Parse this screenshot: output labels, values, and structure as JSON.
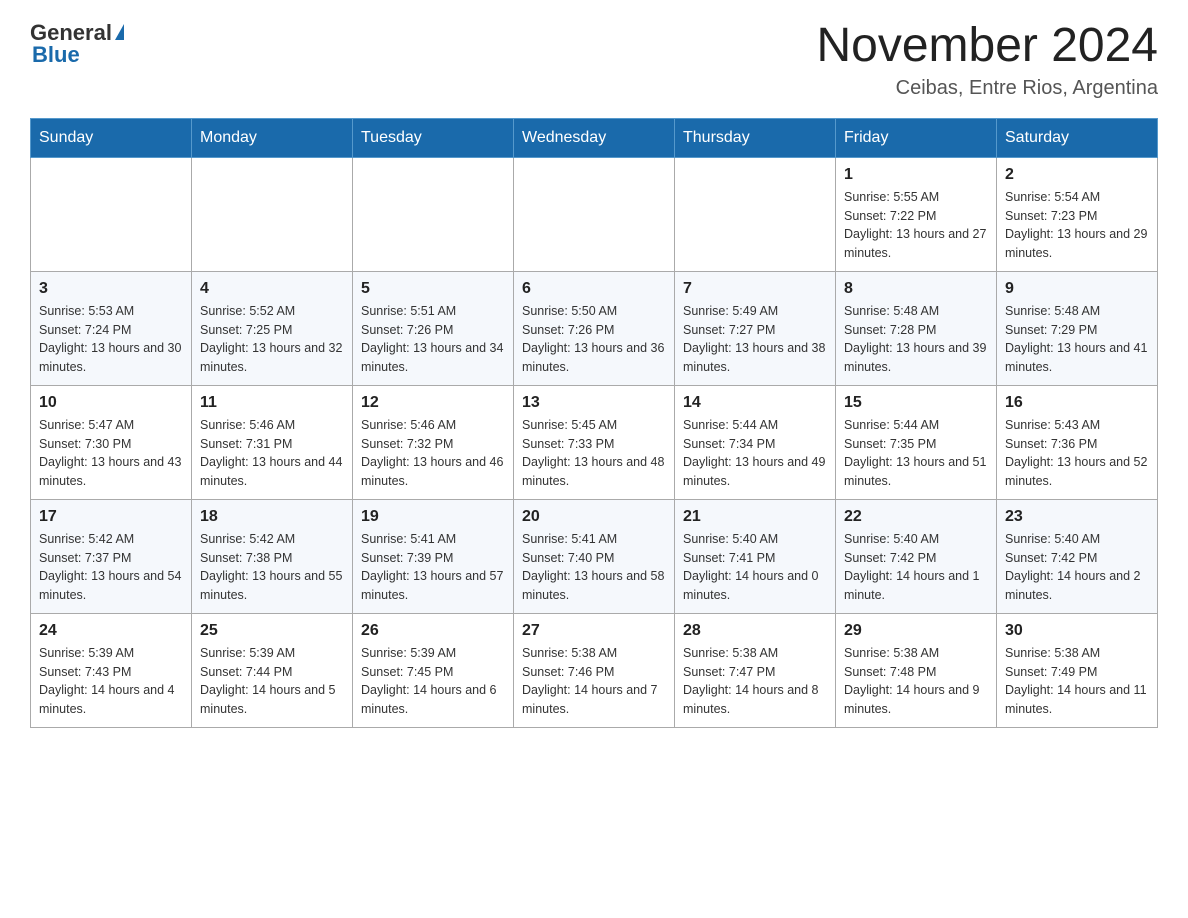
{
  "header": {
    "logo_general": "General",
    "logo_blue": "Blue",
    "month_title": "November 2024",
    "location": "Ceibas, Entre Rios, Argentina"
  },
  "weekdays": [
    "Sunday",
    "Monday",
    "Tuesday",
    "Wednesday",
    "Thursday",
    "Friday",
    "Saturday"
  ],
  "weeks": [
    [
      {
        "day": "",
        "info": ""
      },
      {
        "day": "",
        "info": ""
      },
      {
        "day": "",
        "info": ""
      },
      {
        "day": "",
        "info": ""
      },
      {
        "day": "",
        "info": ""
      },
      {
        "day": "1",
        "info": "Sunrise: 5:55 AM\nSunset: 7:22 PM\nDaylight: 13 hours and 27 minutes."
      },
      {
        "day": "2",
        "info": "Sunrise: 5:54 AM\nSunset: 7:23 PM\nDaylight: 13 hours and 29 minutes."
      }
    ],
    [
      {
        "day": "3",
        "info": "Sunrise: 5:53 AM\nSunset: 7:24 PM\nDaylight: 13 hours and 30 minutes."
      },
      {
        "day": "4",
        "info": "Sunrise: 5:52 AM\nSunset: 7:25 PM\nDaylight: 13 hours and 32 minutes."
      },
      {
        "day": "5",
        "info": "Sunrise: 5:51 AM\nSunset: 7:26 PM\nDaylight: 13 hours and 34 minutes."
      },
      {
        "day": "6",
        "info": "Sunrise: 5:50 AM\nSunset: 7:26 PM\nDaylight: 13 hours and 36 minutes."
      },
      {
        "day": "7",
        "info": "Sunrise: 5:49 AM\nSunset: 7:27 PM\nDaylight: 13 hours and 38 minutes."
      },
      {
        "day": "8",
        "info": "Sunrise: 5:48 AM\nSunset: 7:28 PM\nDaylight: 13 hours and 39 minutes."
      },
      {
        "day": "9",
        "info": "Sunrise: 5:48 AM\nSunset: 7:29 PM\nDaylight: 13 hours and 41 minutes."
      }
    ],
    [
      {
        "day": "10",
        "info": "Sunrise: 5:47 AM\nSunset: 7:30 PM\nDaylight: 13 hours and 43 minutes."
      },
      {
        "day": "11",
        "info": "Sunrise: 5:46 AM\nSunset: 7:31 PM\nDaylight: 13 hours and 44 minutes."
      },
      {
        "day": "12",
        "info": "Sunrise: 5:46 AM\nSunset: 7:32 PM\nDaylight: 13 hours and 46 minutes."
      },
      {
        "day": "13",
        "info": "Sunrise: 5:45 AM\nSunset: 7:33 PM\nDaylight: 13 hours and 48 minutes."
      },
      {
        "day": "14",
        "info": "Sunrise: 5:44 AM\nSunset: 7:34 PM\nDaylight: 13 hours and 49 minutes."
      },
      {
        "day": "15",
        "info": "Sunrise: 5:44 AM\nSunset: 7:35 PM\nDaylight: 13 hours and 51 minutes."
      },
      {
        "day": "16",
        "info": "Sunrise: 5:43 AM\nSunset: 7:36 PM\nDaylight: 13 hours and 52 minutes."
      }
    ],
    [
      {
        "day": "17",
        "info": "Sunrise: 5:42 AM\nSunset: 7:37 PM\nDaylight: 13 hours and 54 minutes."
      },
      {
        "day": "18",
        "info": "Sunrise: 5:42 AM\nSunset: 7:38 PM\nDaylight: 13 hours and 55 minutes."
      },
      {
        "day": "19",
        "info": "Sunrise: 5:41 AM\nSunset: 7:39 PM\nDaylight: 13 hours and 57 minutes."
      },
      {
        "day": "20",
        "info": "Sunrise: 5:41 AM\nSunset: 7:40 PM\nDaylight: 13 hours and 58 minutes."
      },
      {
        "day": "21",
        "info": "Sunrise: 5:40 AM\nSunset: 7:41 PM\nDaylight: 14 hours and 0 minutes."
      },
      {
        "day": "22",
        "info": "Sunrise: 5:40 AM\nSunset: 7:42 PM\nDaylight: 14 hours and 1 minute."
      },
      {
        "day": "23",
        "info": "Sunrise: 5:40 AM\nSunset: 7:42 PM\nDaylight: 14 hours and 2 minutes."
      }
    ],
    [
      {
        "day": "24",
        "info": "Sunrise: 5:39 AM\nSunset: 7:43 PM\nDaylight: 14 hours and 4 minutes."
      },
      {
        "day": "25",
        "info": "Sunrise: 5:39 AM\nSunset: 7:44 PM\nDaylight: 14 hours and 5 minutes."
      },
      {
        "day": "26",
        "info": "Sunrise: 5:39 AM\nSunset: 7:45 PM\nDaylight: 14 hours and 6 minutes."
      },
      {
        "day": "27",
        "info": "Sunrise: 5:38 AM\nSunset: 7:46 PM\nDaylight: 14 hours and 7 minutes."
      },
      {
        "day": "28",
        "info": "Sunrise: 5:38 AM\nSunset: 7:47 PM\nDaylight: 14 hours and 8 minutes."
      },
      {
        "day": "29",
        "info": "Sunrise: 5:38 AM\nSunset: 7:48 PM\nDaylight: 14 hours and 9 minutes."
      },
      {
        "day": "30",
        "info": "Sunrise: 5:38 AM\nSunset: 7:49 PM\nDaylight: 14 hours and 11 minutes."
      }
    ]
  ]
}
